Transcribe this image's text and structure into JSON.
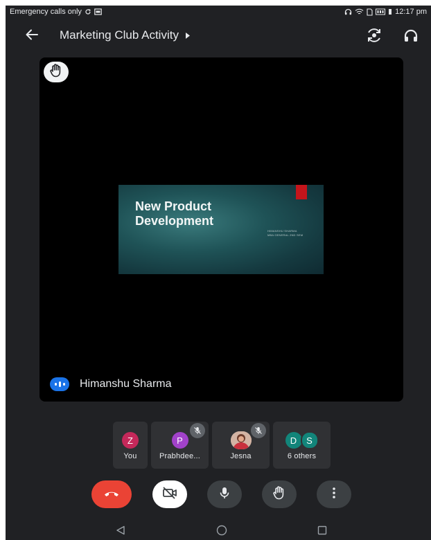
{
  "status_bar": {
    "carrier_text": "Emergency calls only",
    "time": "12:17 pm"
  },
  "app_bar": {
    "title": "Marketing Club Activity",
    "back_icon": "arrow-back-icon",
    "caret_icon": "caret-right-icon",
    "switch_camera_icon": "switch-camera-icon",
    "audio_icon": "headphones-icon"
  },
  "main_tile": {
    "raised_hand_icon": "raised-hand-icon",
    "slide": {
      "title": "New Product Development",
      "subtitle_lines": [
        "HIMANSHU SHARMA",
        "MBA GENERAL 2ND SEM"
      ],
      "accent_color": "#c4151b"
    },
    "presenter_name": "Himanshu Sharma",
    "speaking_icon": "speaking-indicator-icon"
  },
  "participants": [
    {
      "initial": "Z",
      "label": "You",
      "color": "#c5285a",
      "muted": false
    },
    {
      "initial": "P",
      "label": "Prabhdee...",
      "color": "#a142c9",
      "muted": true
    },
    {
      "initial": "",
      "label": "Jesna",
      "color": "",
      "muted": true,
      "photo": true
    },
    {
      "initials": [
        "D",
        "S"
      ],
      "label": "6 others",
      "colors": [
        "#12857a",
        "#12857a"
      ],
      "muted": false
    }
  ],
  "controls": {
    "end_call_icon": "end-call-icon",
    "camera_icon": "camera-off-icon",
    "mic_icon": "microphone-icon",
    "hand_icon": "raise-hand-icon",
    "more_icon": "more-options-icon",
    "end_call_color": "#ea4335"
  },
  "nav_bar": {
    "back_icon": "nav-back-icon",
    "home_icon": "nav-home-icon",
    "recents_icon": "nav-recents-icon"
  }
}
